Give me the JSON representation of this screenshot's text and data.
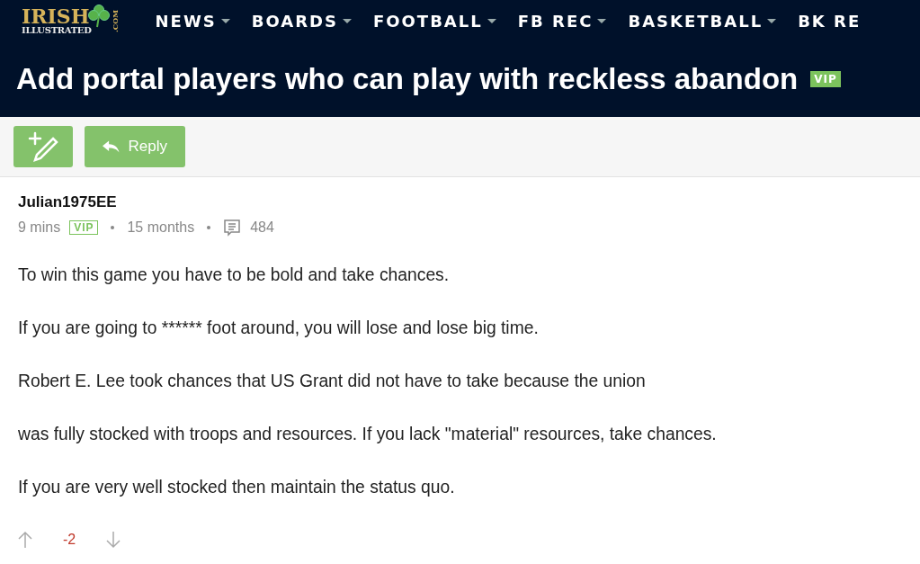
{
  "logo": {
    "top": "IRISH",
    "bottom": "ILLUSTRATED",
    "suffix": ".COM"
  },
  "nav": [
    {
      "label": "NEWS",
      "dropdown": true
    },
    {
      "label": "BOARDS",
      "dropdown": true
    },
    {
      "label": "FOOTBALL",
      "dropdown": true
    },
    {
      "label": "FB REC",
      "dropdown": true
    },
    {
      "label": "BASKETBALL",
      "dropdown": true
    },
    {
      "label": "BK RE",
      "dropdown": false
    }
  ],
  "thread": {
    "title": "Add portal players who can play with reckless abandon",
    "badge": "VIP"
  },
  "toolbar": {
    "reply": "Reply"
  },
  "post": {
    "author": "Julian1975EE",
    "time": "9 mins",
    "badge": "VIP",
    "tenure": "15 months",
    "posts": "484",
    "paragraphs": [
      "To win this game you have to be bold and take chances.",
      "If you are going to ****** foot around, you will lose and lose big time.",
      "Robert E. Lee took chances that US Grant did not have to take because the union",
      "was fully stocked with troops and resources. If you lack \"material\" resources, take chances.",
      "If you are very well stocked then maintain the status quo."
    ],
    "score": "-2"
  }
}
